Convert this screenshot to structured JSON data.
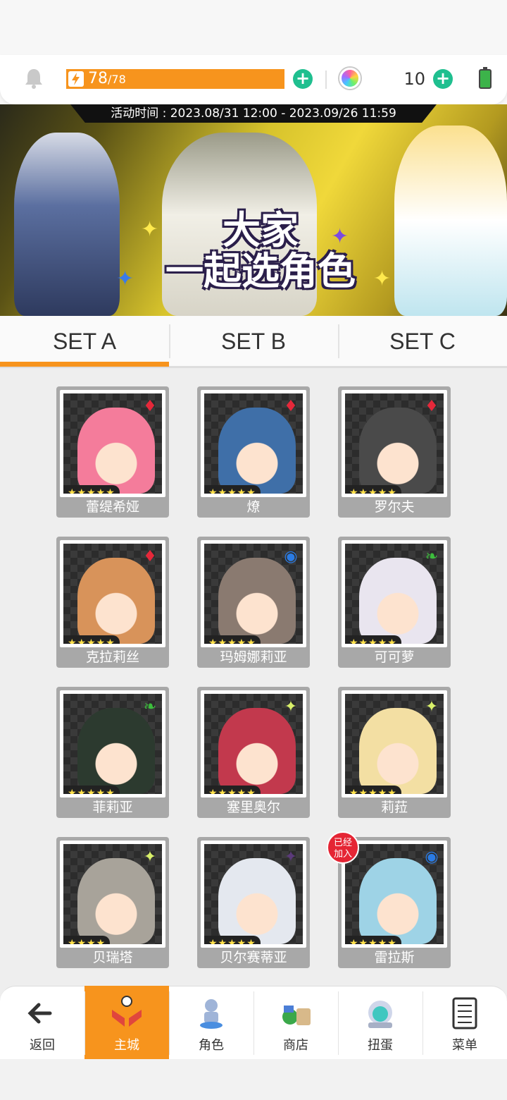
{
  "header": {
    "stamina_current": "78",
    "stamina_max": "/78",
    "gem_count": "10"
  },
  "banner": {
    "event_time": "活动时间 : 2023.08/31 12:00 - 2023.09/26 11:59",
    "title_line1": "大家",
    "title_line2": "一起选角色"
  },
  "tabs": [
    {
      "label": "SET A",
      "active": true
    },
    {
      "label": "SET B",
      "active": false
    },
    {
      "label": "SET C",
      "active": false
    }
  ],
  "characters": [
    {
      "name": "蕾缇希娅",
      "element": "fire",
      "stars": "★★★★★",
      "color": "#f47c9b"
    },
    {
      "name": "燎",
      "element": "fire",
      "stars": "★★★★★",
      "color": "#3f6fa8"
    },
    {
      "name": "罗尔夫",
      "element": "fire",
      "stars": "★★★★★",
      "color": "#4a4a4a"
    },
    {
      "name": "克拉莉丝",
      "element": "fire",
      "stars": "★★★★★",
      "color": "#d8935a"
    },
    {
      "name": "玛姆娜莉亚",
      "element": "water",
      "stars": "★★★★★",
      "color": "#8a7a70"
    },
    {
      "name": "可可萝",
      "element": "wind",
      "stars": "★★★★★",
      "color": "#e9e5ef"
    },
    {
      "name": "菲莉亚",
      "element": "wind",
      "stars": "★★★★★",
      "color": "#2c3a2f"
    },
    {
      "name": "塞里奥尔",
      "element": "light",
      "stars": "★★★★★",
      "color": "#c2394d"
    },
    {
      "name": "莉菈",
      "element": "light",
      "stars": "★★★★★",
      "color": "#f3dfa3"
    },
    {
      "name": "贝瑞塔",
      "element": "light",
      "stars": "★★★★",
      "color": "#a8a39a"
    },
    {
      "name": "贝尔赛蒂亚",
      "element": "dark",
      "stars": "★★★★★",
      "color": "#e4e8ef"
    },
    {
      "name": "雷拉斯",
      "element": "water",
      "stars": "★★★★★",
      "color": "#9ed3e6",
      "badge": "已经\n加入"
    }
  ],
  "nav": [
    {
      "label": "返回",
      "icon": "back-arrow-icon"
    },
    {
      "label": "主城",
      "icon": "castle-icon",
      "active": true
    },
    {
      "label": "角色",
      "icon": "character-icon"
    },
    {
      "label": "商店",
      "icon": "shop-icon"
    },
    {
      "label": "扭蛋",
      "icon": "gacha-icon"
    },
    {
      "label": "菜单",
      "icon": "menu-icon"
    }
  ],
  "colors": {
    "accent": "#f7941d",
    "plus": "#1fbf8f",
    "fire": "#e6283a",
    "water": "#2a7be4",
    "wind": "#3dbd3d"
  }
}
